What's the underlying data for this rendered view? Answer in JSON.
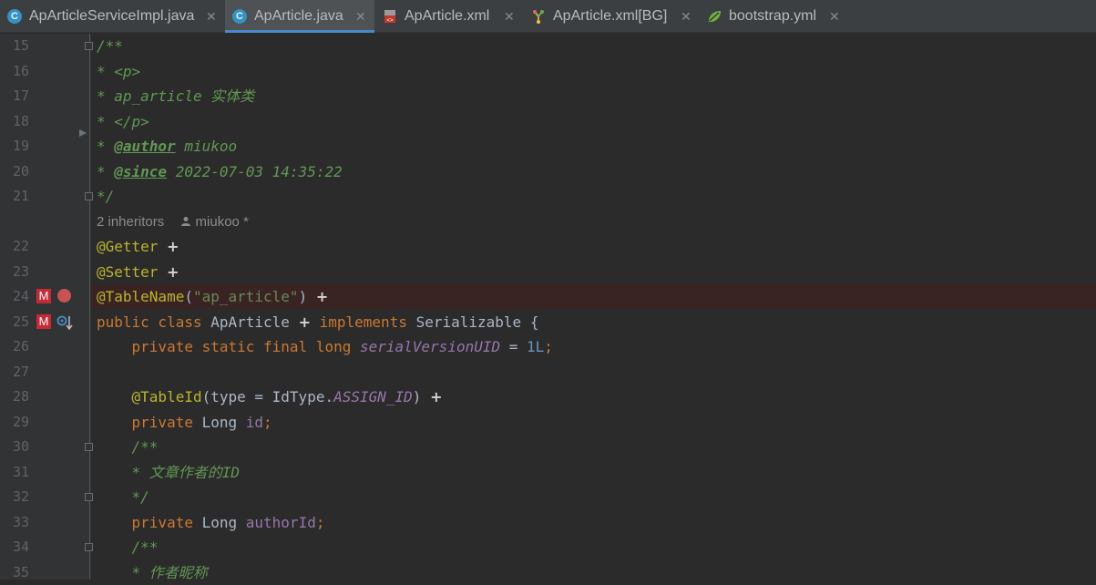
{
  "tabs": [
    {
      "label": "ApArticleServiceImpl.java",
      "icon": "java-class-icon",
      "active": false
    },
    {
      "label": "ApArticle.java",
      "icon": "java-class-icon",
      "active": true
    },
    {
      "label": "ApArticle.xml",
      "icon": "mybatis-xml-icon",
      "active": false
    },
    {
      "label": "ApArticle.xml[BG]",
      "icon": "xml-tree-icon",
      "active": false
    },
    {
      "label": "bootstrap.yml",
      "icon": "spring-leaf-icon",
      "active": false
    }
  ],
  "close_glyph": "✕",
  "gutter": {
    "line_numbers": [
      "15",
      "16",
      "17",
      "18",
      "19",
      "20",
      "21",
      "22",
      "23",
      "24",
      "25",
      "26",
      "27",
      "28",
      "29",
      "30",
      "31",
      "32",
      "33",
      "34",
      "35"
    ],
    "mybatis_badge": "M"
  },
  "code": {
    "l15": {
      "doc": "/**"
    },
    "l16": {
      "doc": "* <p>"
    },
    "l17": {
      "doc": "* ap_article 实体类"
    },
    "l18": {
      "doc": "* </p>"
    },
    "l19": {
      "star": "* ",
      "tag": "@author",
      "text": " miukoo"
    },
    "l20": {
      "star": "* ",
      "tag": "@since",
      "text": " 2022-07-03 14:35:22"
    },
    "l21": {
      "doc": "*/"
    },
    "hint": {
      "inheritors": "2 inheritors",
      "author": "miukoo *"
    },
    "l22": {
      "ann": "@Getter"
    },
    "l23": {
      "ann": "@Setter"
    },
    "l24": {
      "ann": "@TableName",
      "open": "(",
      "str": "\"ap_article\"",
      "close": ")"
    },
    "l25": {
      "kw1": "public class ",
      "name": "ApArticle",
      "kw2": "implements",
      "rest": " Serializable {"
    },
    "l26": {
      "kw": "private static final long ",
      "field": "serialVersionUID",
      "op": " = ",
      "num": "1L",
      "semi": ";"
    },
    "l28": {
      "ann": "@TableId",
      "mid": "(type = IdType.",
      "const": "ASSIGN_ID",
      "close": ")"
    },
    "l29": {
      "kw": "private ",
      "type": "Long ",
      "field": "id",
      "semi": ";"
    },
    "l30": {
      "doc": "/**"
    },
    "l31": {
      "doc": "* 文章作者的ID"
    },
    "l32": {
      "doc": "*/"
    },
    "l33": {
      "kw": "private ",
      "type": "Long ",
      "field": "authorId",
      "semi": ";"
    },
    "l34": {
      "doc": "/**"
    },
    "l35": {
      "doc": "* 作者昵称"
    }
  },
  "plus_glyph": "+",
  "colors": {
    "keyword": "#cc7832",
    "annotation": "#bbb529",
    "doc_comment": "#629755",
    "field": "#9876aa",
    "string": "#6a8759",
    "number": "#6897bb",
    "error_line": "#3a2323"
  }
}
